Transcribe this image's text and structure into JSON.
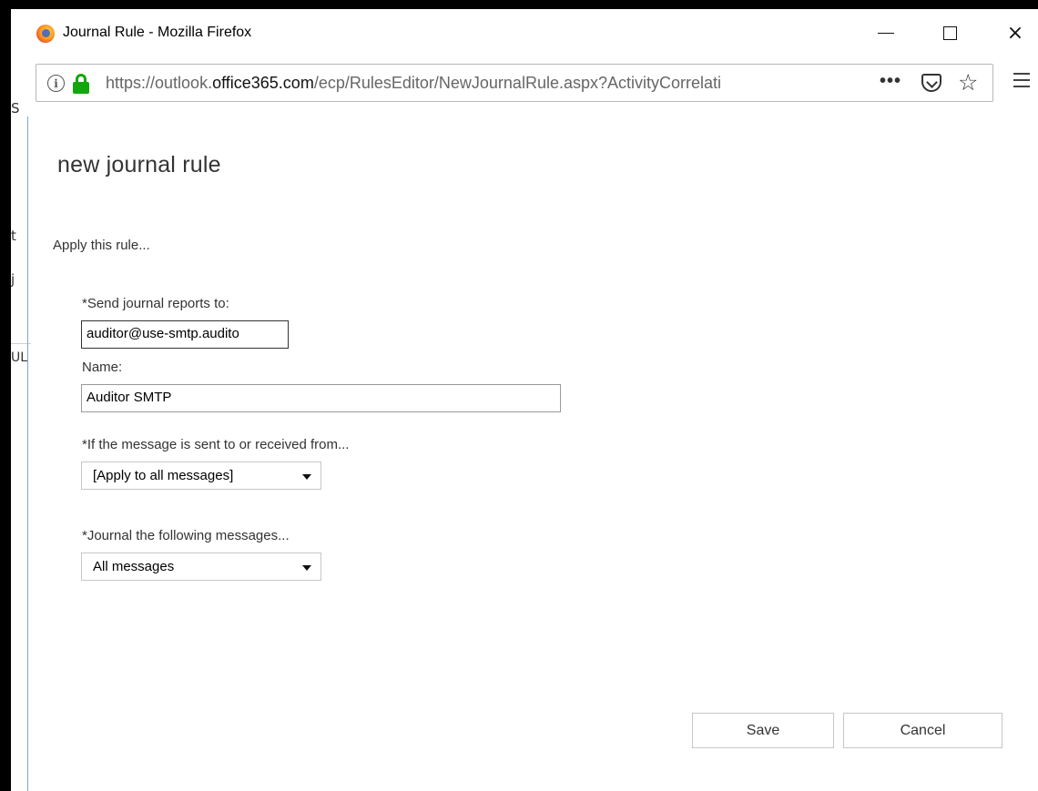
{
  "window": {
    "title": "Journal Rule - Mozilla Firefox",
    "minimize_icon": "minimize-icon",
    "maximize_icon": "maximize-icon",
    "close_glyph": "×"
  },
  "address_bar": {
    "url_prefix": "https://outlook.",
    "url_domain": "office365.com",
    "url_suffix": "/ecp/RulesEditor/NewJournalRule.aspx?ActivityCorrelati",
    "more_glyph": "•••",
    "star_glyph": "☆",
    "lock_color": "#12a60d"
  },
  "background_window": {
    "fragments": [
      "S",
      "t",
      "j",
      "UL"
    ]
  },
  "form": {
    "page_title": "new journal rule",
    "section_label": "Apply this rule...",
    "send_to_label": "*Send journal reports to:",
    "send_to_value": "auditor@use-smtp.audito",
    "name_label": "Name:",
    "name_value": "Auditor SMTP",
    "condition_label": "*If the message is sent to or received from...",
    "condition_value": "[Apply to all messages]",
    "scope_label": "*Journal the following messages...",
    "scope_value": "All messages"
  },
  "buttons": {
    "save": "Save",
    "cancel": "Cancel"
  }
}
